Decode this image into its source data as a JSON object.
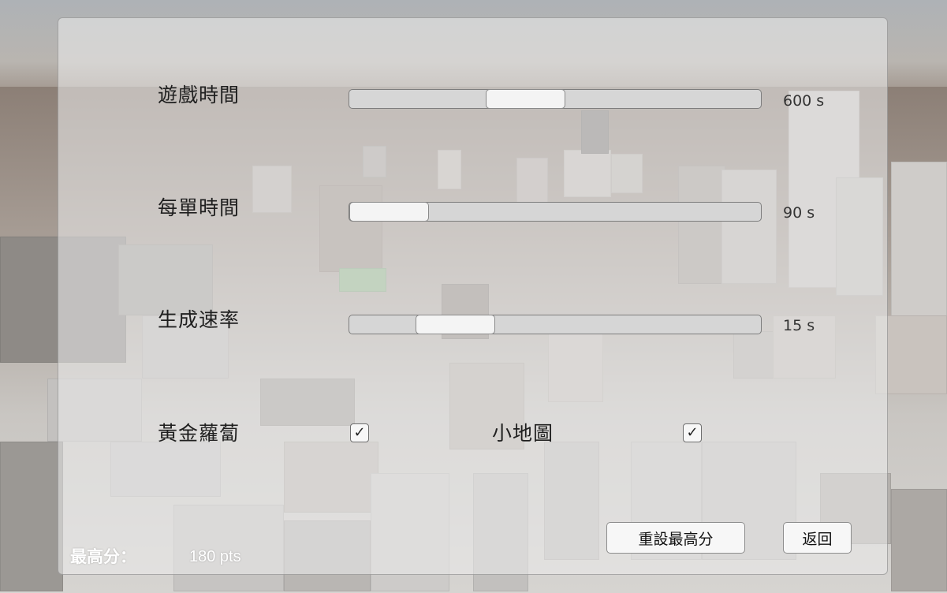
{
  "settings": {
    "game_time": {
      "label": "遊戲時間",
      "value_text": "600 s",
      "fraction": 0.41
    },
    "order_time": {
      "label": "每單時間",
      "value_text": "90 s",
      "fraction": 0.0
    },
    "spawn_rate": {
      "label": "生成速率",
      "value_text": "15 s",
      "fraction": 0.2
    },
    "golden_radish": {
      "label": "黃金蘿蔔",
      "checked": true,
      "check_glyph": "✓"
    },
    "minimap": {
      "label": "小地圖",
      "checked": true,
      "check_glyph": "✓"
    }
  },
  "buttons": {
    "reset_high_score": "重設最高分",
    "back": "返回"
  },
  "high_score": {
    "label": "最高分：",
    "value": "180 pts"
  },
  "colors": {
    "panel_bg": "rgba(236,236,236,0.56)",
    "slider_track": "#d6d6d6",
    "slider_thumb": "#f4f4f4",
    "score_text": "#ffffff"
  }
}
